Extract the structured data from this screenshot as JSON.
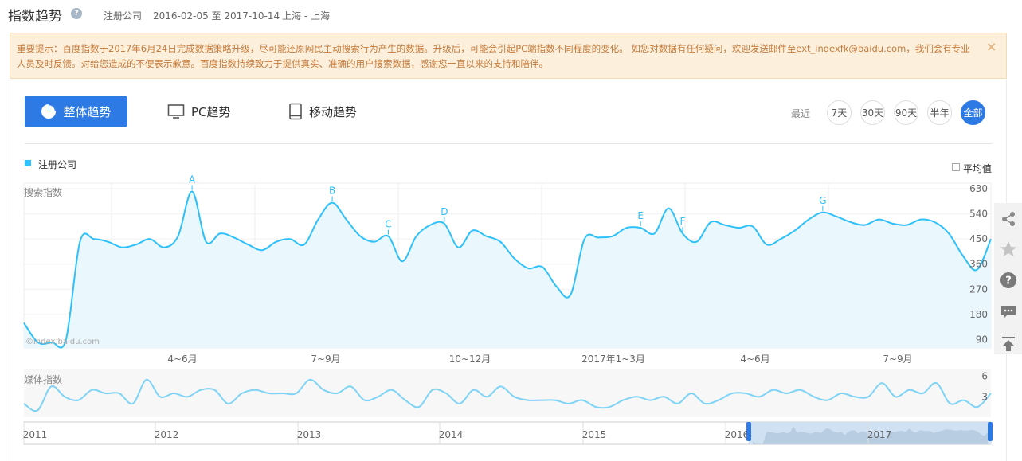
{
  "header": {
    "title": "指数趋势",
    "keyword": "注册公司",
    "date_range": "2016-02-05 至 2017-10-14",
    "region": "上海 - 上海",
    "help_glyph": "?"
  },
  "notice": {
    "text": "重要提示：百度指数于2017年6月24日完成数据策略升级，尽可能还原网民主动搜索行为产生的数据。升级后，可能会引起PC端指数不同程度的变化。 如您对数据有任何疑问，欢迎发送邮件至ext_indexfk@baidu.com，我们会有专业人员及时反馈。对给您造成的不便表示歉意。百度指数持续致力于提供真实、准确的用户搜索数据，感谢您一直以来的支持和陪伴。",
    "close_glyph": "×"
  },
  "tabs": [
    {
      "label": "整体趋势",
      "icon": "pie-chart-icon"
    },
    {
      "label": "PC趋势",
      "icon": "monitor-icon"
    },
    {
      "label": "移动趋势",
      "icon": "mobile-icon"
    }
  ],
  "range": {
    "label": "最近",
    "options": [
      "7天",
      "30天",
      "90天",
      "半年",
      "全部"
    ],
    "selected": "全部"
  },
  "legend": {
    "series_name": "注册公司",
    "avg_label": "平均值"
  },
  "search_label": "搜索指数",
  "media_label": "媒体指数",
  "watermark": "©index.baidu.com",
  "colors": {
    "accent": "#2d7ae5",
    "series": "#2ec0f9",
    "notice_bg": "#fcf0dc",
    "notice_text": "#c57a3a"
  },
  "sidebar_icons": [
    "share-icon",
    "star-icon",
    "help-icon",
    "comment-icon",
    "back-to-top-icon"
  ],
  "chart_data": [
    {
      "type": "line",
      "name": "search-index",
      "ylabel": "搜索指数",
      "ylim": [
        60,
        650
      ],
      "yticks": [
        90,
        180,
        270,
        360,
        450,
        540,
        630
      ],
      "x_tick_labels": [
        "4~6月",
        "7~9月",
        "10~12月",
        "2017年1~3月",
        "4~6月",
        "7~9月"
      ],
      "annotations": [
        {
          "label": "A",
          "index": 12
        },
        {
          "label": "B",
          "index": 22
        },
        {
          "label": "C",
          "index": 26
        },
        {
          "label": "D",
          "index": 30
        },
        {
          "label": "E",
          "index": 44
        },
        {
          "label": "F",
          "index": 47
        },
        {
          "label": "G",
          "index": 57
        }
      ],
      "series": [
        {
          "name": "注册公司",
          "values": [
            150,
            80,
            80,
            90,
            440,
            450,
            440,
            420,
            430,
            450,
            420,
            460,
            620,
            440,
            470,
            455,
            430,
            410,
            440,
            450,
            430,
            520,
            580,
            520,
            460,
            440,
            460,
            370,
            460,
            500,
            505,
            420,
            480,
            460,
            440,
            380,
            345,
            350,
            280,
            250,
            450,
            455,
            460,
            490,
            490,
            470,
            560,
            470,
            440,
            510,
            500,
            490,
            495,
            430,
            450,
            480,
            520,
            545,
            530,
            510,
            500,
            520,
            505,
            500,
            520,
            510,
            470,
            390,
            340,
            450
          ]
        }
      ]
    },
    {
      "type": "line",
      "name": "media-index",
      "ylabel": "媒体指数",
      "yticks": [
        3,
        6
      ],
      "ylim": [
        0,
        7
      ],
      "series": [
        {
          "name": "注册公司",
          "values": [
            2,
            1,
            4.5,
            3,
            2.5,
            4,
            3.5,
            3.5,
            2,
            5.5,
            3,
            3.5,
            3,
            4,
            4,
            2,
            3.5,
            4,
            3.5,
            3.5,
            3.5,
            5.5,
            4,
            3.5,
            4.5,
            2.5,
            3,
            4,
            2.5,
            1.5,
            4,
            3.5,
            2,
            4,
            3,
            4.5,
            3,
            2.5,
            2.5,
            2.5,
            2,
            2.5,
            1.5,
            1.5,
            2.5,
            3,
            2.5,
            3,
            2,
            3.5,
            2,
            2.5,
            3.5,
            3.5,
            3,
            4,
            3.5,
            4,
            3,
            2.5,
            3.5,
            3,
            3,
            5,
            3,
            4,
            3.5,
            5,
            2,
            2.5,
            1.5,
            3.5
          ]
        }
      ]
    },
    {
      "type": "area",
      "name": "overview-navigator",
      "year_labels": [
        "2011",
        "2012",
        "2013",
        "2014",
        "2015",
        "2016",
        "2017"
      ],
      "selection": [
        "2016-02-05",
        "2017-10-14"
      ]
    }
  ]
}
